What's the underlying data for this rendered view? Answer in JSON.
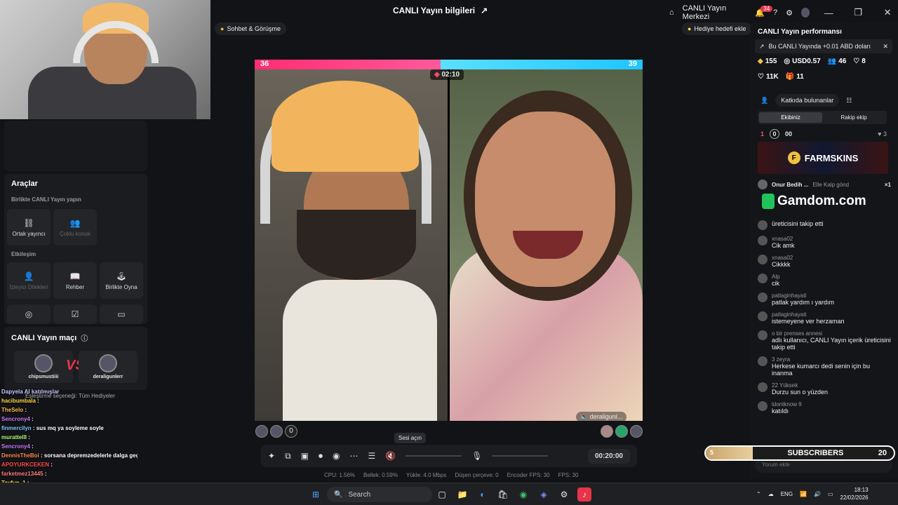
{
  "window": {
    "title": "CANLI Yayın bilgileri",
    "center_link": "CANLI Yayın Merkezi",
    "notif_count": "34"
  },
  "topbar": {
    "chat_tag": "Sohbet & Görüşme",
    "gift_goal": "Hediye hedefi ekle"
  },
  "tools": {
    "title": "Araçlar",
    "section1": "Birlikte CANLI Yayın yapın",
    "cohost": "Ortak yayıncı",
    "multiguest": "Çoklu konuk",
    "section2": "Etkileşim",
    "viewer_requests": "İzleyici Dilekleri",
    "guide": "Rehber",
    "play_together": "Birlikte Oyna"
  },
  "match": {
    "title": "CANLI Yayın maçı",
    "left_user": "chipsmustiiii",
    "right_user": "deraligunlerr",
    "vs": "VS"
  },
  "chat_overlay": [
    {
      "name": "Dapyela AI katılmışlar",
      "text": ""
    },
    {
      "name": "hacibumbala",
      "text": ":"
    },
    {
      "name": "TheSelo",
      "text": ":"
    },
    {
      "name": "Sencrony4",
      "text": ":"
    },
    {
      "name": "finmercilyn",
      "text": ": sus mq ya soyleme soyle"
    },
    {
      "name": "murattelll",
      "text": ":"
    },
    {
      "name": "Sencrony4",
      "text": ":"
    },
    {
      "name": "DennisTheBoi",
      "text": ": sorsana depremzedelerle dalga geçerken müslüman mıymış? @chips"
    },
    {
      "name": "APOYURKCEKEN",
      "text": ":"
    },
    {
      "name": "farketmez13445",
      "text": ":"
    },
    {
      "name": "Tayfun_1",
      "text": ":"
    }
  ],
  "chat_overlay_gift": "Eşleştirme seçeneği: Tüm Hediyeler",
  "battle": {
    "left_score": "36",
    "right_score": "39",
    "timer": "02:10",
    "right_name": "deraligunl...",
    "left_score_ratio": 0.48
  },
  "controls": {
    "tooltip": "Sesi açın",
    "time": "00:20:00"
  },
  "stats": [
    "CPU: 1.56%",
    "Bellek: 0.59%",
    "Yükle: 4.0 Mbps",
    "Düşen çerçeve: 0",
    "Encoder FPS: 30",
    "FPS: 30"
  ],
  "perf": {
    "title": "CANLI Yayın performansı",
    "banner": "Bu CANLI Yayında +0.01 ABD doları",
    "diamonds": "155",
    "usd": "USD0.57",
    "viewers": "46",
    "likes_people": "8",
    "likes": "11K",
    "gifts": "11"
  },
  "contributors": {
    "label": "Katkıda bulunanlar",
    "tab_ours": "Ekibiniz",
    "tab_rival": "Rakip ekip",
    "rank": "1",
    "score": "00",
    "heart_count": "3",
    "zero": "0"
  },
  "ads": {
    "farmskins": "FARMSKINS",
    "gamdom": "Gamdom.com"
  },
  "gift_row": {
    "user": "Onur Bedih ...",
    "action": "Elle Kalp gönd",
    "count": "×1"
  },
  "chat": [
    {
      "user": "",
      "text": "üreticisini takip etti"
    },
    {
      "user": "xnasa02",
      "text": "Cik amk"
    },
    {
      "user": "xnasa02",
      "text": "Cikkkk"
    },
    {
      "user": "Alp",
      "text": "cik"
    },
    {
      "user": "patlaginhayati",
      "text": "patlak yardım ı yardım"
    },
    {
      "user": "patlaginhayati",
      "text": "istemeyene ver herzaman"
    },
    {
      "user": "o bir prenses annesi",
      "text": "adlı kullanıcı, CANLI Yayın içerik üreticisini takip etti"
    },
    {
      "user": "3 zeyra",
      "text": "Herkese kumarcı dedi senin için bu inanma"
    },
    {
      "user": "22 Yüksek",
      "text": "Durzu sun o yüzden"
    },
    {
      "user": "ldontknow 9",
      "text": "katıldı"
    }
  ],
  "comment_placeholder": "Yorum ekle",
  "subscribers": {
    "label": "SUBSCRIBERS",
    "current": "5",
    "goal": "20",
    "progress": 0.25
  },
  "taskbar": {
    "search": "Search",
    "lang": "ENG",
    "time": "18:13",
    "date": "22/02/2026"
  },
  "colors": {
    "accent_pink": "#ff2d72",
    "accent_blue": "#20c4ff",
    "bg": "#121316"
  }
}
